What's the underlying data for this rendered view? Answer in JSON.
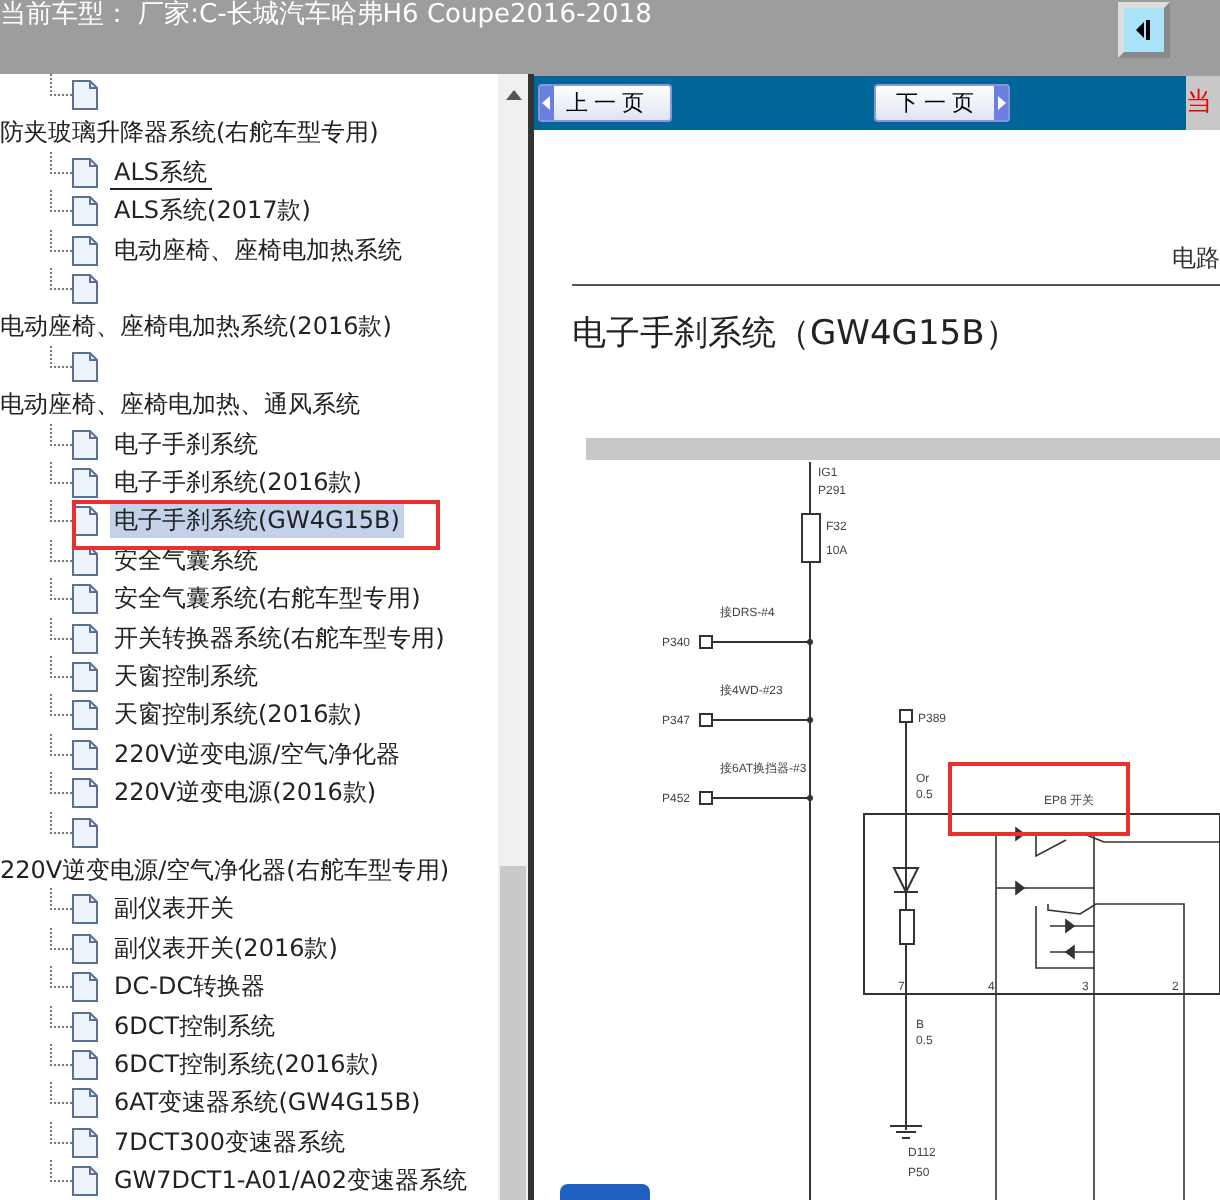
{
  "header": {
    "title": "当前车型：  厂家:C-长城汽车哈弗H6 Coupe2016-2018"
  },
  "tree": [
    {
      "kind": "group",
      "children": [
        {
          "kind": "leaf",
          "selected": false,
          "hovered": false
        }
      ]
    },
    {
      "kind": "group",
      "label": "防夹玻璃升降器系统(右舵车型专用)",
      "children": [
        {
          "kind": "leaf",
          "label": "ALS系统",
          "selected": false,
          "hovered": true
        },
        {
          "kind": "leaf",
          "label": "ALS系统(2017款)",
          "selected": false,
          "hovered": false
        },
        {
          "kind": "leaf",
          "label": "电动座椅、座椅电加热系统",
          "selected": false,
          "hovered": false
        },
        {
          "kind": "leaf",
          "selected": false,
          "hovered": false
        }
      ]
    },
    {
      "kind": "group",
      "label": "电动座椅、座椅电加热系统(2016款)",
      "children": [
        {
          "kind": "leaf",
          "selected": false,
          "hovered": false
        }
      ]
    },
    {
      "kind": "group",
      "label": "电动座椅、座椅电加热、通风系统",
      "children": [
        {
          "kind": "leaf",
          "label": "电子手刹系统",
          "selected": false,
          "hovered": false
        },
        {
          "kind": "leaf",
          "label": "电子手刹系统(2016款)",
          "selected": false,
          "hovered": false
        },
        {
          "kind": "leaf",
          "label": "电子手刹系统(GW4G15B)",
          "selected": true,
          "hovered": false
        },
        {
          "kind": "leaf",
          "label": "安全气囊系统",
          "selected": false,
          "hovered": false
        },
        {
          "kind": "leaf",
          "label": "安全气囊系统(右舵车型专用)",
          "selected": false,
          "hovered": false
        },
        {
          "kind": "leaf",
          "label": "开关转换器系统(右舵车型专用)",
          "selected": false,
          "hovered": false
        },
        {
          "kind": "leaf",
          "label": "天窗控制系统",
          "selected": false,
          "hovered": false
        },
        {
          "kind": "leaf",
          "label": "天窗控制系统(2016款)",
          "selected": false,
          "hovered": false
        },
        {
          "kind": "leaf",
          "label": "220V逆变电源/空气净化器",
          "selected": false,
          "hovered": false
        },
        {
          "kind": "leaf",
          "label": "220V逆变电源(2016款)",
          "selected": false,
          "hovered": false
        },
        {
          "kind": "leaf",
          "selected": false,
          "hovered": false
        }
      ]
    },
    {
      "kind": "group",
      "label": "220V逆变电源/空气净化器(右舵车型专用)",
      "children": [
        {
          "kind": "leaf",
          "label": "副仪表开关",
          "selected": false,
          "hovered": false
        },
        {
          "kind": "leaf",
          "label": "副仪表开关(2016款)",
          "selected": false,
          "hovered": false
        },
        {
          "kind": "leaf",
          "label": "DC-DC转换器",
          "selected": false,
          "hovered": false
        },
        {
          "kind": "leaf",
          "label": "6DCT控制系统",
          "selected": false,
          "hovered": false
        },
        {
          "kind": "leaf",
          "label": "6DCT控制系统(2016款)",
          "selected": false,
          "hovered": false
        },
        {
          "kind": "leaf",
          "label": "6AT变速器系统(GW4G15B)",
          "selected": false,
          "hovered": false
        },
        {
          "kind": "leaf",
          "label": "7DCT300变速器系统",
          "selected": false,
          "hovered": false
        },
        {
          "kind": "leaf",
          "label": "GW7DCT1-A01/A02变速器系统",
          "selected": false,
          "hovered": false
        }
      ]
    }
  ],
  "toolbar": {
    "prev": "上 一 页",
    "next": "下 一 页",
    "current": "当"
  },
  "document": {
    "header": "电路",
    "title": "电子手刹系统（GW4G15B）",
    "diagram": {
      "supply": "IG1",
      "supply_pin": "P291",
      "fuse": "F32",
      "fuse_rating": "10A",
      "branches": [
        {
          "label": "接DRS-#4",
          "pin": "P340"
        },
        {
          "label": "接4WD-#23",
          "pin": "P347"
        },
        {
          "label": "接6AT换挡器-#3",
          "pin": "P452"
        }
      ],
      "switch_pin": "P389",
      "wire": [
        "Or",
        "0.5"
      ],
      "module": "EP8  开关",
      "terminals": [
        "7",
        "4",
        "3",
        "2"
      ],
      "ground_wire": [
        "B",
        "0.5"
      ],
      "ground": "D112",
      "ground_pin": "P50"
    }
  }
}
